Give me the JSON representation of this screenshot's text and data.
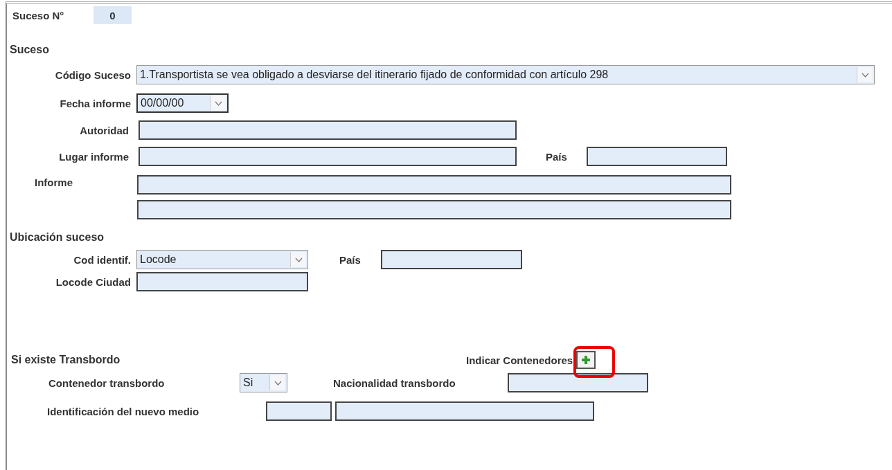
{
  "header": {
    "label": "Suceso N°",
    "value": "0"
  },
  "suceso": {
    "title": "Suceso",
    "codigo": {
      "label": "Código Suceso",
      "value": "1.Transportista se vea obligado a desviarse del itinerario fijado de conformidad con artículo 298"
    },
    "fecha": {
      "label": "Fecha informe",
      "value": "00/00/00"
    },
    "autoridad": {
      "label": "Autoridad"
    },
    "lugar": {
      "label": "Lugar informe"
    },
    "pais": {
      "label": "País"
    },
    "informe": {
      "label": "Informe"
    }
  },
  "ubicacion": {
    "title": "Ubicación suceso",
    "cod_identif": {
      "label": "Cod identif.",
      "value": "Locode"
    },
    "pais": {
      "label": "País"
    },
    "locode_ciudad": {
      "label": "Locode Ciudad"
    }
  },
  "transbordo": {
    "title": "Si existe Transbordo",
    "indicar": {
      "label": "Indicar Contenedores",
      "highlighted": true
    },
    "contenedor": {
      "label": "Contenedor transbordo",
      "value": "Si"
    },
    "nacionalidad": {
      "label": "Nacionalidad transbordo"
    },
    "identificacion": {
      "label": "Identificación del nuevo medio"
    }
  }
}
